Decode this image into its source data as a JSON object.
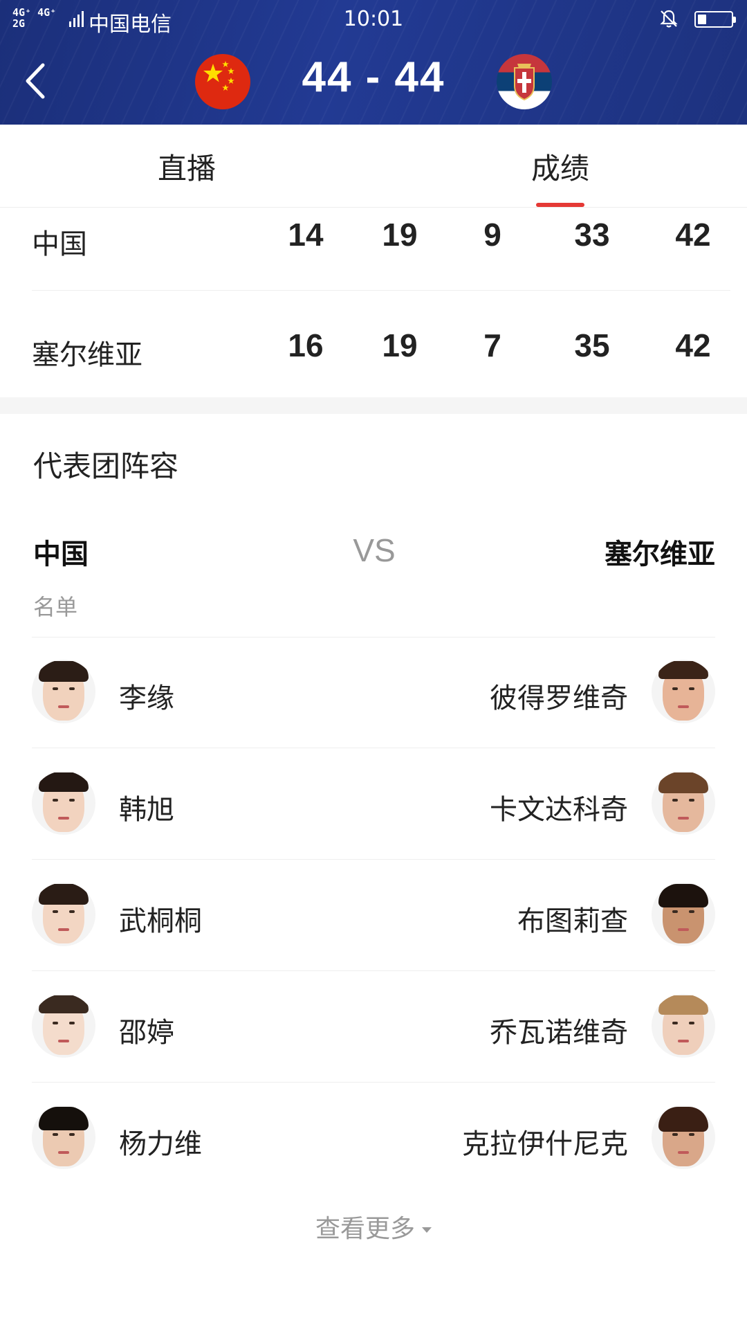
{
  "status_bar": {
    "network": "4G⁺ 4G⁺\n2G",
    "carrier": "中国电信",
    "time": "10:01"
  },
  "header": {
    "score": "44 - 44",
    "home_flag": "china-flag-icon",
    "away_flag": "serbia-flag-icon"
  },
  "tabs": [
    {
      "label": "直播",
      "active": false
    },
    {
      "label": "成绩",
      "active": true
    }
  ],
  "score_table": {
    "rows": [
      {
        "team": "中国",
        "values": [
          "14",
          "19",
          "9",
          "33",
          "42"
        ]
      },
      {
        "team": "塞尔维亚",
        "values": [
          "16",
          "19",
          "7",
          "35",
          "42"
        ]
      }
    ]
  },
  "lineup": {
    "title": "代表团阵容",
    "home_team": "中国",
    "vs": "VS",
    "away_team": "塞尔维亚",
    "roster_label": "名单",
    "players": [
      {
        "home": "李缘",
        "away": "彼得罗维奇"
      },
      {
        "home": "韩旭",
        "away": "卡文达科奇"
      },
      {
        "home": "武桐桐",
        "away": "布图莉查"
      },
      {
        "home": "邵婷",
        "away": "乔瓦诺维奇"
      },
      {
        "home": "杨力维",
        "away": "克拉伊什尼克"
      }
    ],
    "more_label": "查看更多"
  },
  "colors": {
    "header_bg": "#1f358a",
    "tab_indicator": "#e53935",
    "cn_red": "#de2910",
    "cn_yellow": "#ffde00"
  }
}
